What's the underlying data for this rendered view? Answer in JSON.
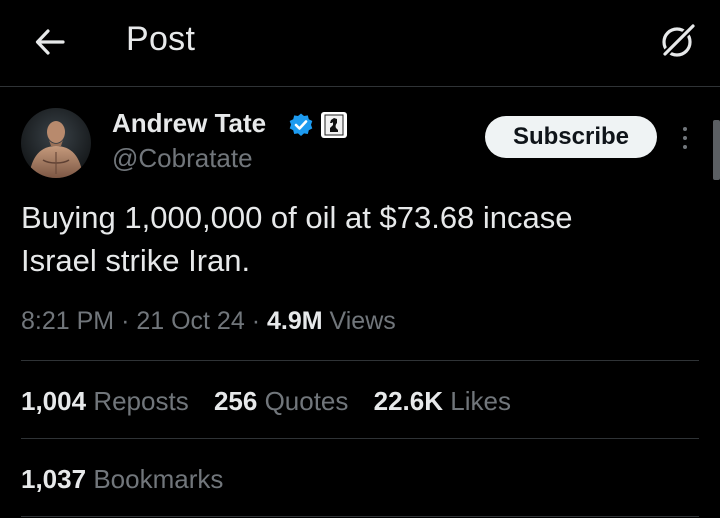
{
  "header": {
    "title": "Post",
    "back_icon": "arrow-left-icon",
    "grok_icon": "grok-icon"
  },
  "post": {
    "author": {
      "name": "Andrew Tate",
      "handle": "@Cobratate",
      "verified_icon": "verified-badge-icon",
      "affiliate_icon": "chess-knight-icon"
    },
    "subscribe_label": "Subscribe",
    "text_line1": "Buying 1,000,000 of oil at $73.68 incase",
    "text_line2": "Israel strike Iran.",
    "time": "8:21 PM",
    "date": "21 Oct 24",
    "separator": "·",
    "views_count": "4.9M",
    "views_label": "Views",
    "stats": {
      "reposts_count": "1,004",
      "reposts_label": "Reposts",
      "quotes_count": "256",
      "quotes_label": "Quotes",
      "likes_count": "22.6K",
      "likes_label": "Likes",
      "bookmarks_count": "1,037",
      "bookmarks_label": "Bookmarks"
    }
  },
  "colors": {
    "background": "#000000",
    "text_primary": "#e7e9ea",
    "text_secondary": "#71767b",
    "divider": "#2f3336",
    "verified_blue": "#1d9bf0",
    "subscribe_bg": "#eff3f4"
  }
}
